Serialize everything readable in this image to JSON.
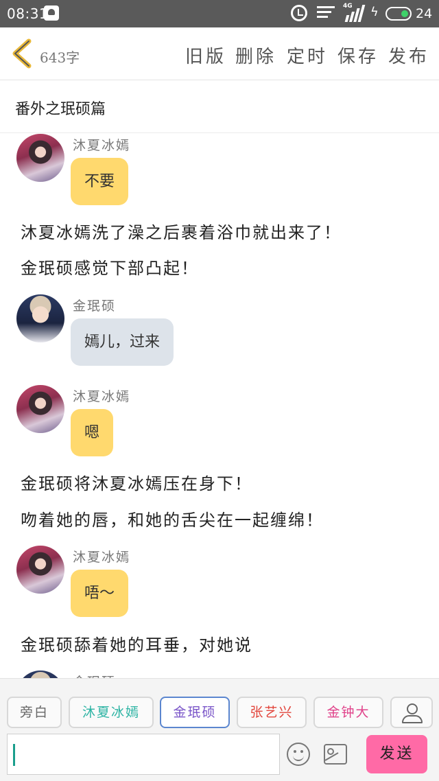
{
  "status_bar": {
    "time": "08:31",
    "network": "4G",
    "battery": "24",
    "icons": [
      "notification-icon",
      "alarm-icon",
      "wifi-icon",
      "signal-icon",
      "charging-icon",
      "battery-icon"
    ]
  },
  "toolbar": {
    "word_count": "643字",
    "actions": [
      "旧版",
      "删除",
      "定时",
      "保存",
      "发布"
    ]
  },
  "story": {
    "title": "番外之珉硕篇"
  },
  "messages": [
    {
      "type": "chat",
      "sender": "沐夏冰嫣",
      "text": "不要",
      "color": "#ffd96e"
    },
    {
      "type": "narration",
      "text": "沐夏冰嫣洗了澡之后裹着浴巾就出来了！"
    },
    {
      "type": "narration",
      "text": "金珉硕感觉下部凸起！"
    },
    {
      "type": "chat",
      "sender": "金珉硕",
      "text": "嫣儿，过来",
      "color": "#dde3ea"
    },
    {
      "type": "chat",
      "sender": "沐夏冰嫣",
      "text": "嗯",
      "color": "#ffd96e"
    },
    {
      "type": "narration",
      "text": "金珉硕将沐夏冰嫣压在身下！"
    },
    {
      "type": "narration",
      "text": "吻着她的唇，和她的舌尖在一起缠绵！"
    },
    {
      "type": "chat",
      "sender": "沐夏冰嫣",
      "text": "唔～",
      "color": "#ffd96e"
    },
    {
      "type": "narration",
      "text": "金珉硕舔着她的耳垂，对她说"
    },
    {
      "type": "chat",
      "sender": "金珉硕",
      "text": "",
      "color": "#dde3ea"
    }
  ],
  "characters": [
    {
      "name": "旁白",
      "color": "#666666",
      "selected": false
    },
    {
      "name": "沐夏冰嫣",
      "color": "#2bb3a3",
      "selected": false
    },
    {
      "name": "金珉硕",
      "color": "#7a55c8",
      "selected": true
    },
    {
      "name": "张艺兴",
      "color": "#e2453c",
      "selected": false
    },
    {
      "name": "金钟大",
      "color": "#e0428a",
      "selected": false
    }
  ],
  "composer": {
    "input_value": "",
    "send_label": "发送",
    "send_color": "#ff6aa6"
  }
}
